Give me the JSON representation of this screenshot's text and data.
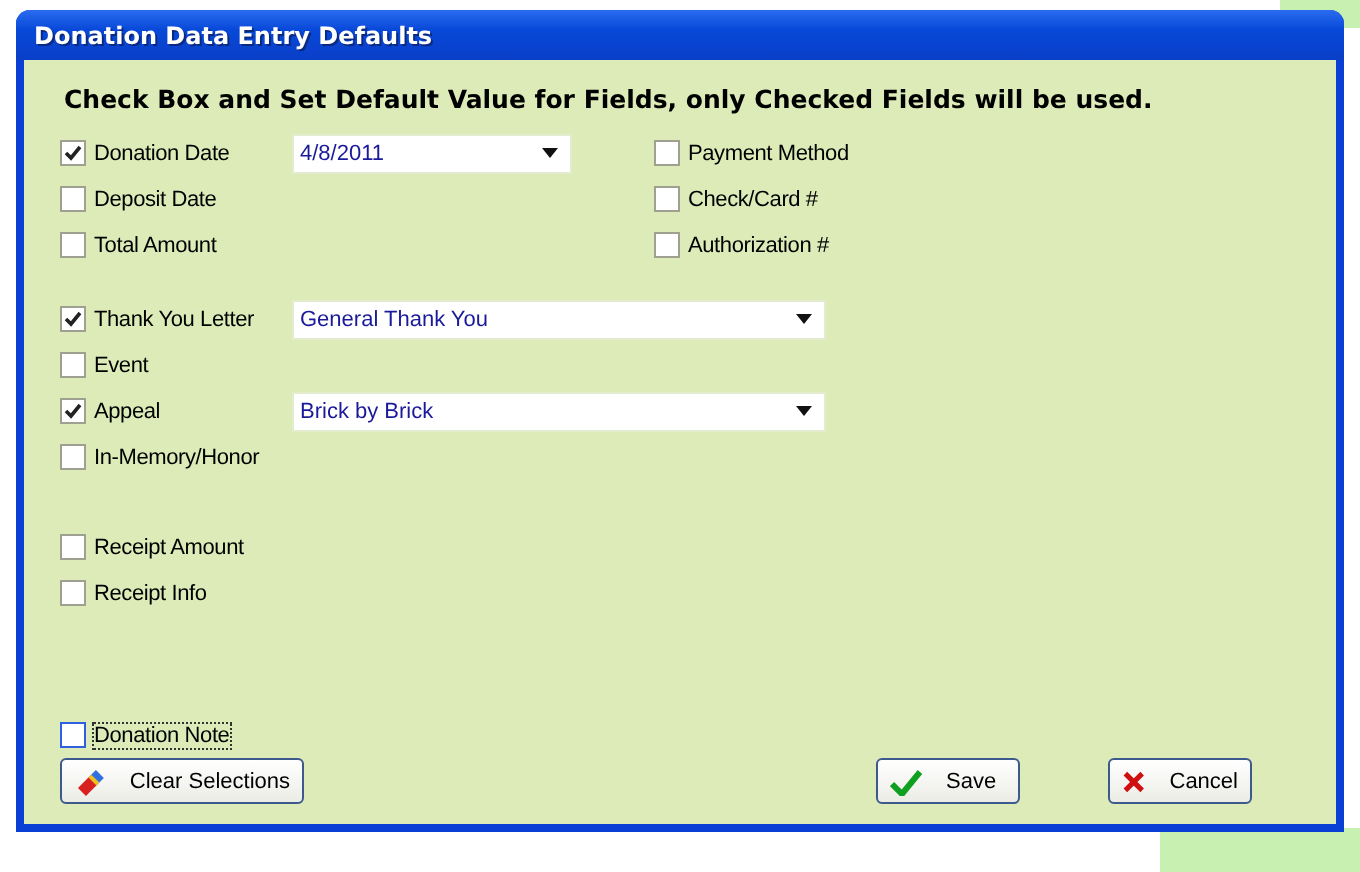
{
  "window": {
    "title": "Donation Data Entry Defaults"
  },
  "instruction": "Check Box and Set Default Value for Fields, only Checked Fields will be used.",
  "groups": [
    {
      "rows": [
        {
          "left": {
            "label": "Donation Date",
            "checked": true,
            "focused": false,
            "value": "4/8/2011"
          },
          "right": {
            "label": "Payment Method",
            "checked": false
          }
        },
        {
          "left": {
            "label": "Deposit Date",
            "checked": false,
            "focused": false
          },
          "right": {
            "label": "Check/Card #",
            "checked": false
          }
        },
        {
          "left": {
            "label": "Total Amount",
            "checked": false,
            "focused": false
          },
          "right": {
            "label": "Authorization #",
            "checked": false
          }
        }
      ]
    },
    {
      "rows": [
        {
          "left": {
            "label": "Thank You Letter",
            "checked": true,
            "focused": false,
            "value": "General Thank You"
          }
        },
        {
          "left": {
            "label": "Event",
            "checked": false,
            "focused": false
          }
        },
        {
          "left": {
            "label": "Appeal",
            "checked": true,
            "focused": false,
            "value": "Brick by Brick"
          }
        },
        {
          "left": {
            "label": "In-Memory/Honor",
            "checked": false,
            "focused": false
          }
        }
      ]
    },
    {
      "rows": [
        {
          "left": {
            "label": "Receipt Amount",
            "checked": false,
            "focused": false
          }
        },
        {
          "left": {
            "label": "Receipt Info",
            "checked": false,
            "focused": false
          }
        }
      ]
    },
    {
      "rows": [
        {
          "left": {
            "label": "Donation Note",
            "checked": false,
            "focused": true
          }
        }
      ]
    }
  ],
  "buttons": [
    {
      "kind": "clear",
      "label": "Clear Selections"
    },
    {
      "kind": "save",
      "label": "Save"
    },
    {
      "kind": "cancel",
      "label": "Cancel"
    }
  ]
}
